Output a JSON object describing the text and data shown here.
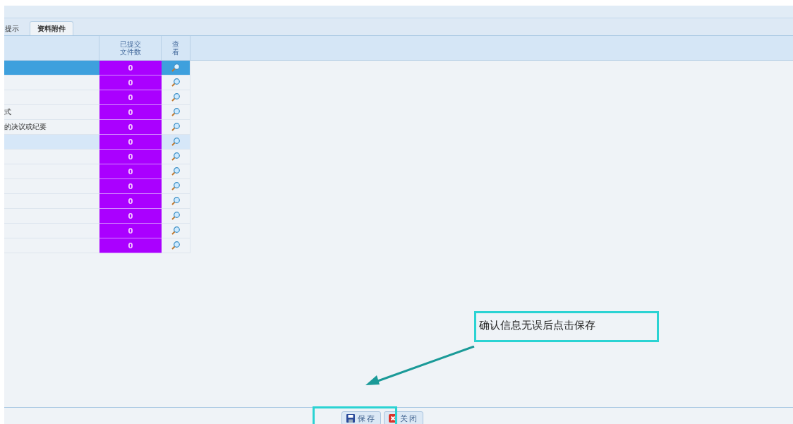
{
  "tabs": [
    {
      "label": "提示",
      "selected": false
    },
    {
      "label": "资料附件",
      "selected": true
    }
  ],
  "table": {
    "columns": [
      "已提交文件数",
      "查看"
    ],
    "rows": [
      {
        "name": "",
        "count": "0",
        "selected": true,
        "highlighted": false
      },
      {
        "name": "",
        "count": "0",
        "selected": false,
        "highlighted": false
      },
      {
        "name": "",
        "count": "0",
        "selected": false,
        "highlighted": false
      },
      {
        "name": "式",
        "count": "0",
        "selected": false,
        "highlighted": false
      },
      {
        "name": "的决议或纪要",
        "count": "0",
        "selected": false,
        "highlighted": false
      },
      {
        "name": "",
        "count": "0",
        "selected": false,
        "highlighted": true
      },
      {
        "name": "",
        "count": "0",
        "selected": false,
        "highlighted": false
      },
      {
        "name": "",
        "count": "0",
        "selected": false,
        "highlighted": false
      },
      {
        "name": "",
        "count": "0",
        "selected": false,
        "highlighted": false
      },
      {
        "name": "",
        "count": "0",
        "selected": false,
        "highlighted": false
      },
      {
        "name": "",
        "count": "0",
        "selected": false,
        "highlighted": false
      },
      {
        "name": "",
        "count": "0",
        "selected": false,
        "highlighted": false
      },
      {
        "name": "",
        "count": "0",
        "selected": false,
        "highlighted": false
      }
    ]
  },
  "callout": {
    "text": "确认信息无误后点击保存"
  },
  "buttons": [
    {
      "label": "保存",
      "kind": "save"
    },
    {
      "label": "关闭",
      "kind": "close"
    }
  ]
}
